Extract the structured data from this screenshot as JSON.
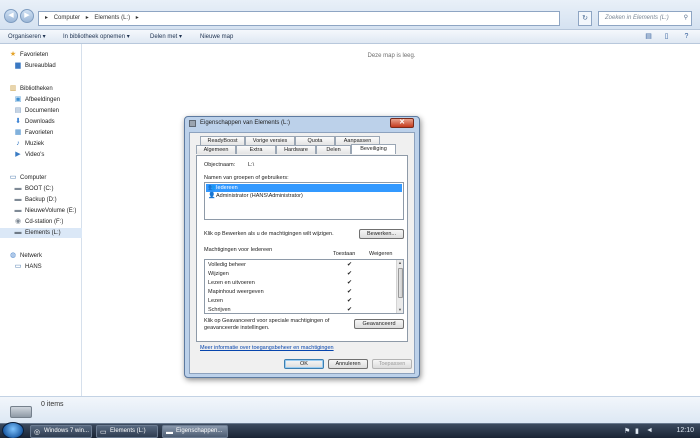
{
  "explorer": {
    "breadcrumb": [
      "Computer",
      "▸",
      "Elements (L:)",
      "▸"
    ],
    "search_placeholder": "Zoeken in Elements (L:)",
    "toolbar": {
      "organize": "Organiseren ▾",
      "include_library": "In bibliotheek opnemen ▾",
      "share": "Delen met ▾",
      "new_folder": "Nieuwe map"
    },
    "empty_message": "Deze map is leeg.",
    "item_count": "0 items"
  },
  "sidebar": {
    "favorites_header": "Favorieten",
    "favorites": [
      "Bureaublad"
    ],
    "libraries_header": "Bibliotheken",
    "libraries": [
      "Afbeeldingen",
      "Documenten",
      "Downloads",
      "Favorieten",
      "Muziek",
      "Video's"
    ],
    "computer_header": "Computer",
    "drives": [
      "BOOT (C:)",
      "Backup (D:)",
      "NieuweVolume (E:)",
      "Cd-station (F:)",
      "Elements (L:)"
    ],
    "network_header": "Netwerk",
    "network": [
      "HANS"
    ]
  },
  "dialog": {
    "title": "Eigenschappen van Elements (L:)",
    "tabs_row1": [
      "ReadyBoost",
      "Vorige versies",
      "Quota",
      "Aanpassen"
    ],
    "tabs_row2": [
      "Algemeen",
      "Extra",
      "Hardware",
      "Delen",
      "Beveiliging"
    ],
    "object_name_label": "Objectnaam:",
    "object_name_value": "L:\\",
    "groups_label": "Namen van groepen of gebruikers:",
    "groups": [
      "Iedereen",
      "Administrator (HANS\\Administrator)"
    ],
    "edit_hint": "Klik op Bewerken als u de machtigingen wilt wijzigen.",
    "edit_button": "Bewerken...",
    "permissions_label": "Machtigingen voor Iedereen",
    "allow_header": "Toestaan",
    "deny_header": "Weigeren",
    "permissions": [
      {
        "name": "Volledig beheer",
        "allow": "✔"
      },
      {
        "name": "Wijzigen",
        "allow": "✔"
      },
      {
        "name": "Lezen en uitvoeren",
        "allow": "✔"
      },
      {
        "name": "Mapinhoud weergeven",
        "allow": "✔"
      },
      {
        "name": "Lezen",
        "allow": "✔"
      },
      {
        "name": "Schrijven",
        "allow": "✔"
      }
    ],
    "advanced_hint": "Klik op Geavanceerd voor speciale machtigingen of geavanceerde instellingen.",
    "advanced_button": "Geavanceerd",
    "more_info_link": "Meer informatie over toegangsbeheer en machtigingen",
    "ok": "OK",
    "cancel": "Annuleren",
    "apply": "Toepassen"
  },
  "taskbar": {
    "buttons": [
      "Windows 7 win...",
      "Elements (L:)",
      "Eigenschappen..."
    ],
    "clock": "12:10"
  }
}
